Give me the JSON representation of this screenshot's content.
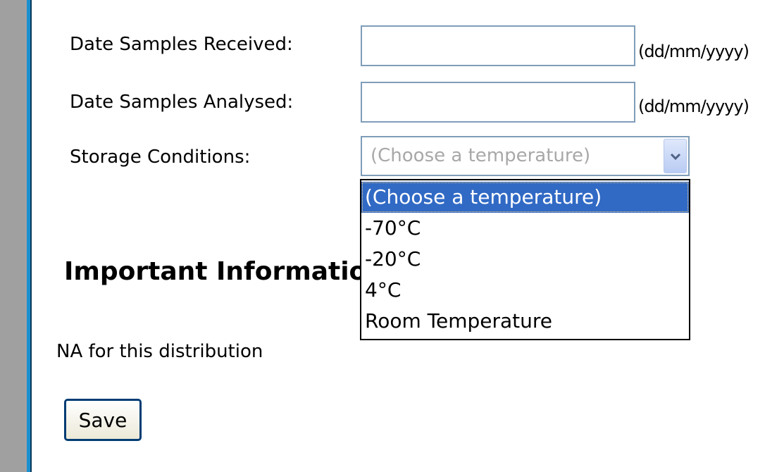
{
  "form": {
    "date_received": {
      "label": "Date Samples Received:",
      "value": "",
      "hint": "(dd/mm/yyyy)"
    },
    "date_analysed": {
      "label": "Date Samples Analysed:",
      "value": "",
      "hint": "(dd/mm/yyyy)"
    },
    "storage": {
      "label": "Storage Conditions:",
      "selected": "(Choose a temperature)",
      "options": [
        "(Choose a temperature)",
        "-70°C",
        "-20°C",
        "4°C",
        "Room Temperature"
      ]
    }
  },
  "important": {
    "heading": "Important Information",
    "text": "NA for this distribution"
  },
  "actions": {
    "save_label": "Save"
  },
  "colors": {
    "accent": "#1a8fd0",
    "selection": "#316ac5",
    "input_border": "#7f9db9",
    "gutter": "#a0a0a0"
  }
}
